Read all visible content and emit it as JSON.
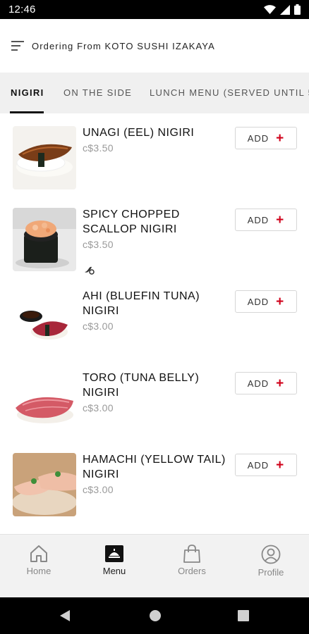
{
  "status_bar": {
    "time": "12:46"
  },
  "header": {
    "title": "Ordering From KOTO SUSHI IZAKAYA"
  },
  "tabs": [
    {
      "label": "NIGIRI"
    },
    {
      "label": "ON THE SIDE"
    },
    {
      "label": "LUNCH MENU (SERVED UNTIL 5"
    }
  ],
  "items": [
    {
      "name": "UNAGI (EEL) NIGIRI",
      "price": "c$3.50",
      "add_label": "ADD",
      "spicy": false
    },
    {
      "name": "SPICY CHOPPED SCALLOP NIGIRI",
      "price": "c$3.50",
      "add_label": "ADD",
      "spicy": true
    },
    {
      "name": "AHI (BLUEFIN TUNA) NIGIRI",
      "price": "c$3.00",
      "add_label": "ADD",
      "spicy": false
    },
    {
      "name": "TORO (TUNA BELLY) NIGIRI",
      "price": "c$3.00",
      "add_label": "ADD",
      "spicy": false
    },
    {
      "name": "HAMACHI (YELLOW TAIL) NIGIRI",
      "price": "c$3.00",
      "add_label": "ADD",
      "spicy": false
    }
  ],
  "bottom_nav": [
    {
      "label": "Home",
      "icon": "home-icon"
    },
    {
      "label": "Menu",
      "icon": "menu-icon"
    },
    {
      "label": "Orders",
      "icon": "shopping-bag-icon"
    },
    {
      "label": "Profile",
      "icon": "profile-icon"
    }
  ],
  "colors": {
    "accent": "#d0021b",
    "tab_bar": "#f0f0f0",
    "bottom_nav": "#f2f2f2"
  }
}
